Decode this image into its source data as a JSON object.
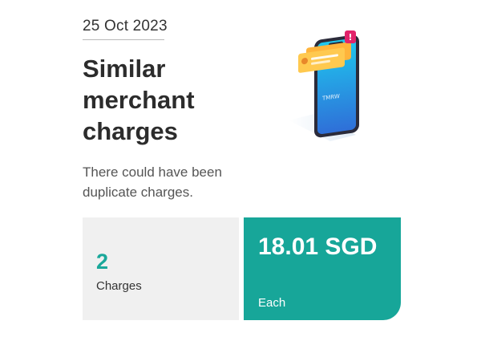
{
  "header": {
    "date": "25 Oct 2023",
    "title": "Similar merchant charges",
    "subtitle": "There could have been duplicate charges."
  },
  "illustration": {
    "icon": "phone-notification-icon",
    "screen_text": "TMRW",
    "alert_badge": "!"
  },
  "summary": {
    "charges_count": "2",
    "charges_label": "Charges",
    "amount_value": "18.01 SGD",
    "amount_label": "Each"
  },
  "colors": {
    "accent": "#17a699",
    "count_text": "#1aa89a",
    "card_gray": "#f0f0f0",
    "alert": "#e2246b"
  }
}
